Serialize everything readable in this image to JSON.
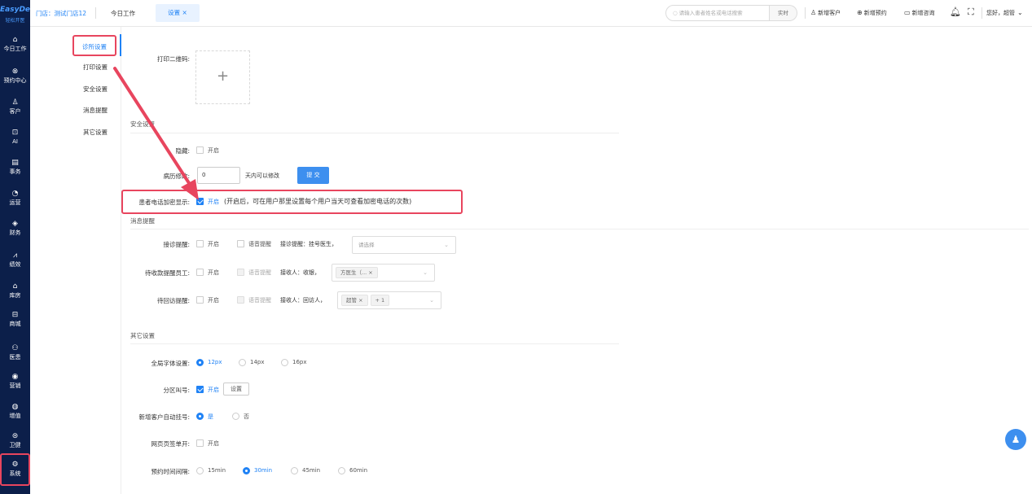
{
  "app": {
    "logo": "EasyDent",
    "logo_sub": "轻松开医"
  },
  "nav": [
    {
      "icon": "⌂",
      "label": "今日工作"
    },
    {
      "icon": "⊗",
      "label": "预约中心"
    },
    {
      "icon": "♙",
      "label": "客户"
    },
    {
      "icon": "⊡",
      "label": "AI"
    },
    {
      "icon": "▤",
      "label": "事务"
    },
    {
      "icon": "◔",
      "label": "运营"
    },
    {
      "icon": "◈",
      "label": "财务"
    },
    {
      "icon": "⩘",
      "label": "绩效"
    },
    {
      "icon": "⌂",
      "label": "库房"
    },
    {
      "icon": "⊟",
      "label": "商城"
    },
    {
      "icon": "⚇",
      "label": "医患"
    },
    {
      "icon": "◉",
      "label": "营销"
    },
    {
      "icon": "◍",
      "label": "增值"
    },
    {
      "icon": "⊜",
      "label": "卫健"
    },
    {
      "icon": "⚙",
      "label": "系统"
    }
  ],
  "topbar": {
    "store": "门店：测试门店12",
    "tab_today": "今日工作",
    "tab_settings": "设置 ×",
    "search_placeholder": "请输入患者姓名或电话搜索",
    "realtime": "实时",
    "new_customer": "新增客户",
    "new_appointment": "新增预约",
    "new_consult": "新增咨询",
    "greeting": "您好，超管"
  },
  "submenu": [
    "诊所设置",
    "打印设置",
    "安全设置",
    "消息提醒",
    "其它设置"
  ],
  "print": {
    "qr_label": "打印二维码:",
    "plus": "+"
  },
  "security": {
    "title": "安全设置",
    "row1_label": "隐藏:",
    "row1_opt": "开启",
    "row2_label": "病历修改:",
    "row2_value": "0",
    "row2_suffix": "天内可以修改",
    "submit": "提 交",
    "enc_label": "患者电话加密显示:",
    "enc_opt": "开启",
    "enc_note": "(开启后，可在用户那里设置每个用户当天可查看加密电话的次数)"
  },
  "messages": {
    "title": "消息提醒",
    "rows": [
      {
        "label": "接诊提醒:",
        "open": "开启",
        "voice": "语音提醒",
        "extra": "接诊提醒：挂号医生，",
        "select_placeholder": "请选择"
      },
      {
        "label": "待收款提醒员工:",
        "open": "开启",
        "voice": "语音提醒",
        "extra": "接收人：收银，",
        "tag": "方医生（..."
      },
      {
        "label": "待回访提醒:",
        "open": "开启",
        "voice": "语音提醒",
        "extra": "接收人：回访人，",
        "tag": "超管",
        "tag_more": "+ 1"
      }
    ]
  },
  "other": {
    "title": "其它设置",
    "font_label": "全局字体设置:",
    "font_options": [
      "12px",
      "14px",
      "16px"
    ],
    "zone_label": "分区叫号:",
    "zone_opt": "开启",
    "zone_btn": "设置",
    "auto_reg_label": "新增客户自动挂号:",
    "auto_reg_yes": "是",
    "auto_reg_no": "否",
    "single_label": "网页页签单开:",
    "single_opt": "开启",
    "interval_label": "预约时间间隔:",
    "interval_options": [
      "15min",
      "30min",
      "45min",
      "60min"
    ]
  },
  "colors": {
    "accent": "#1f82f5",
    "nav_bg": "#0c1f4a",
    "highlight": "#e8455e"
  }
}
